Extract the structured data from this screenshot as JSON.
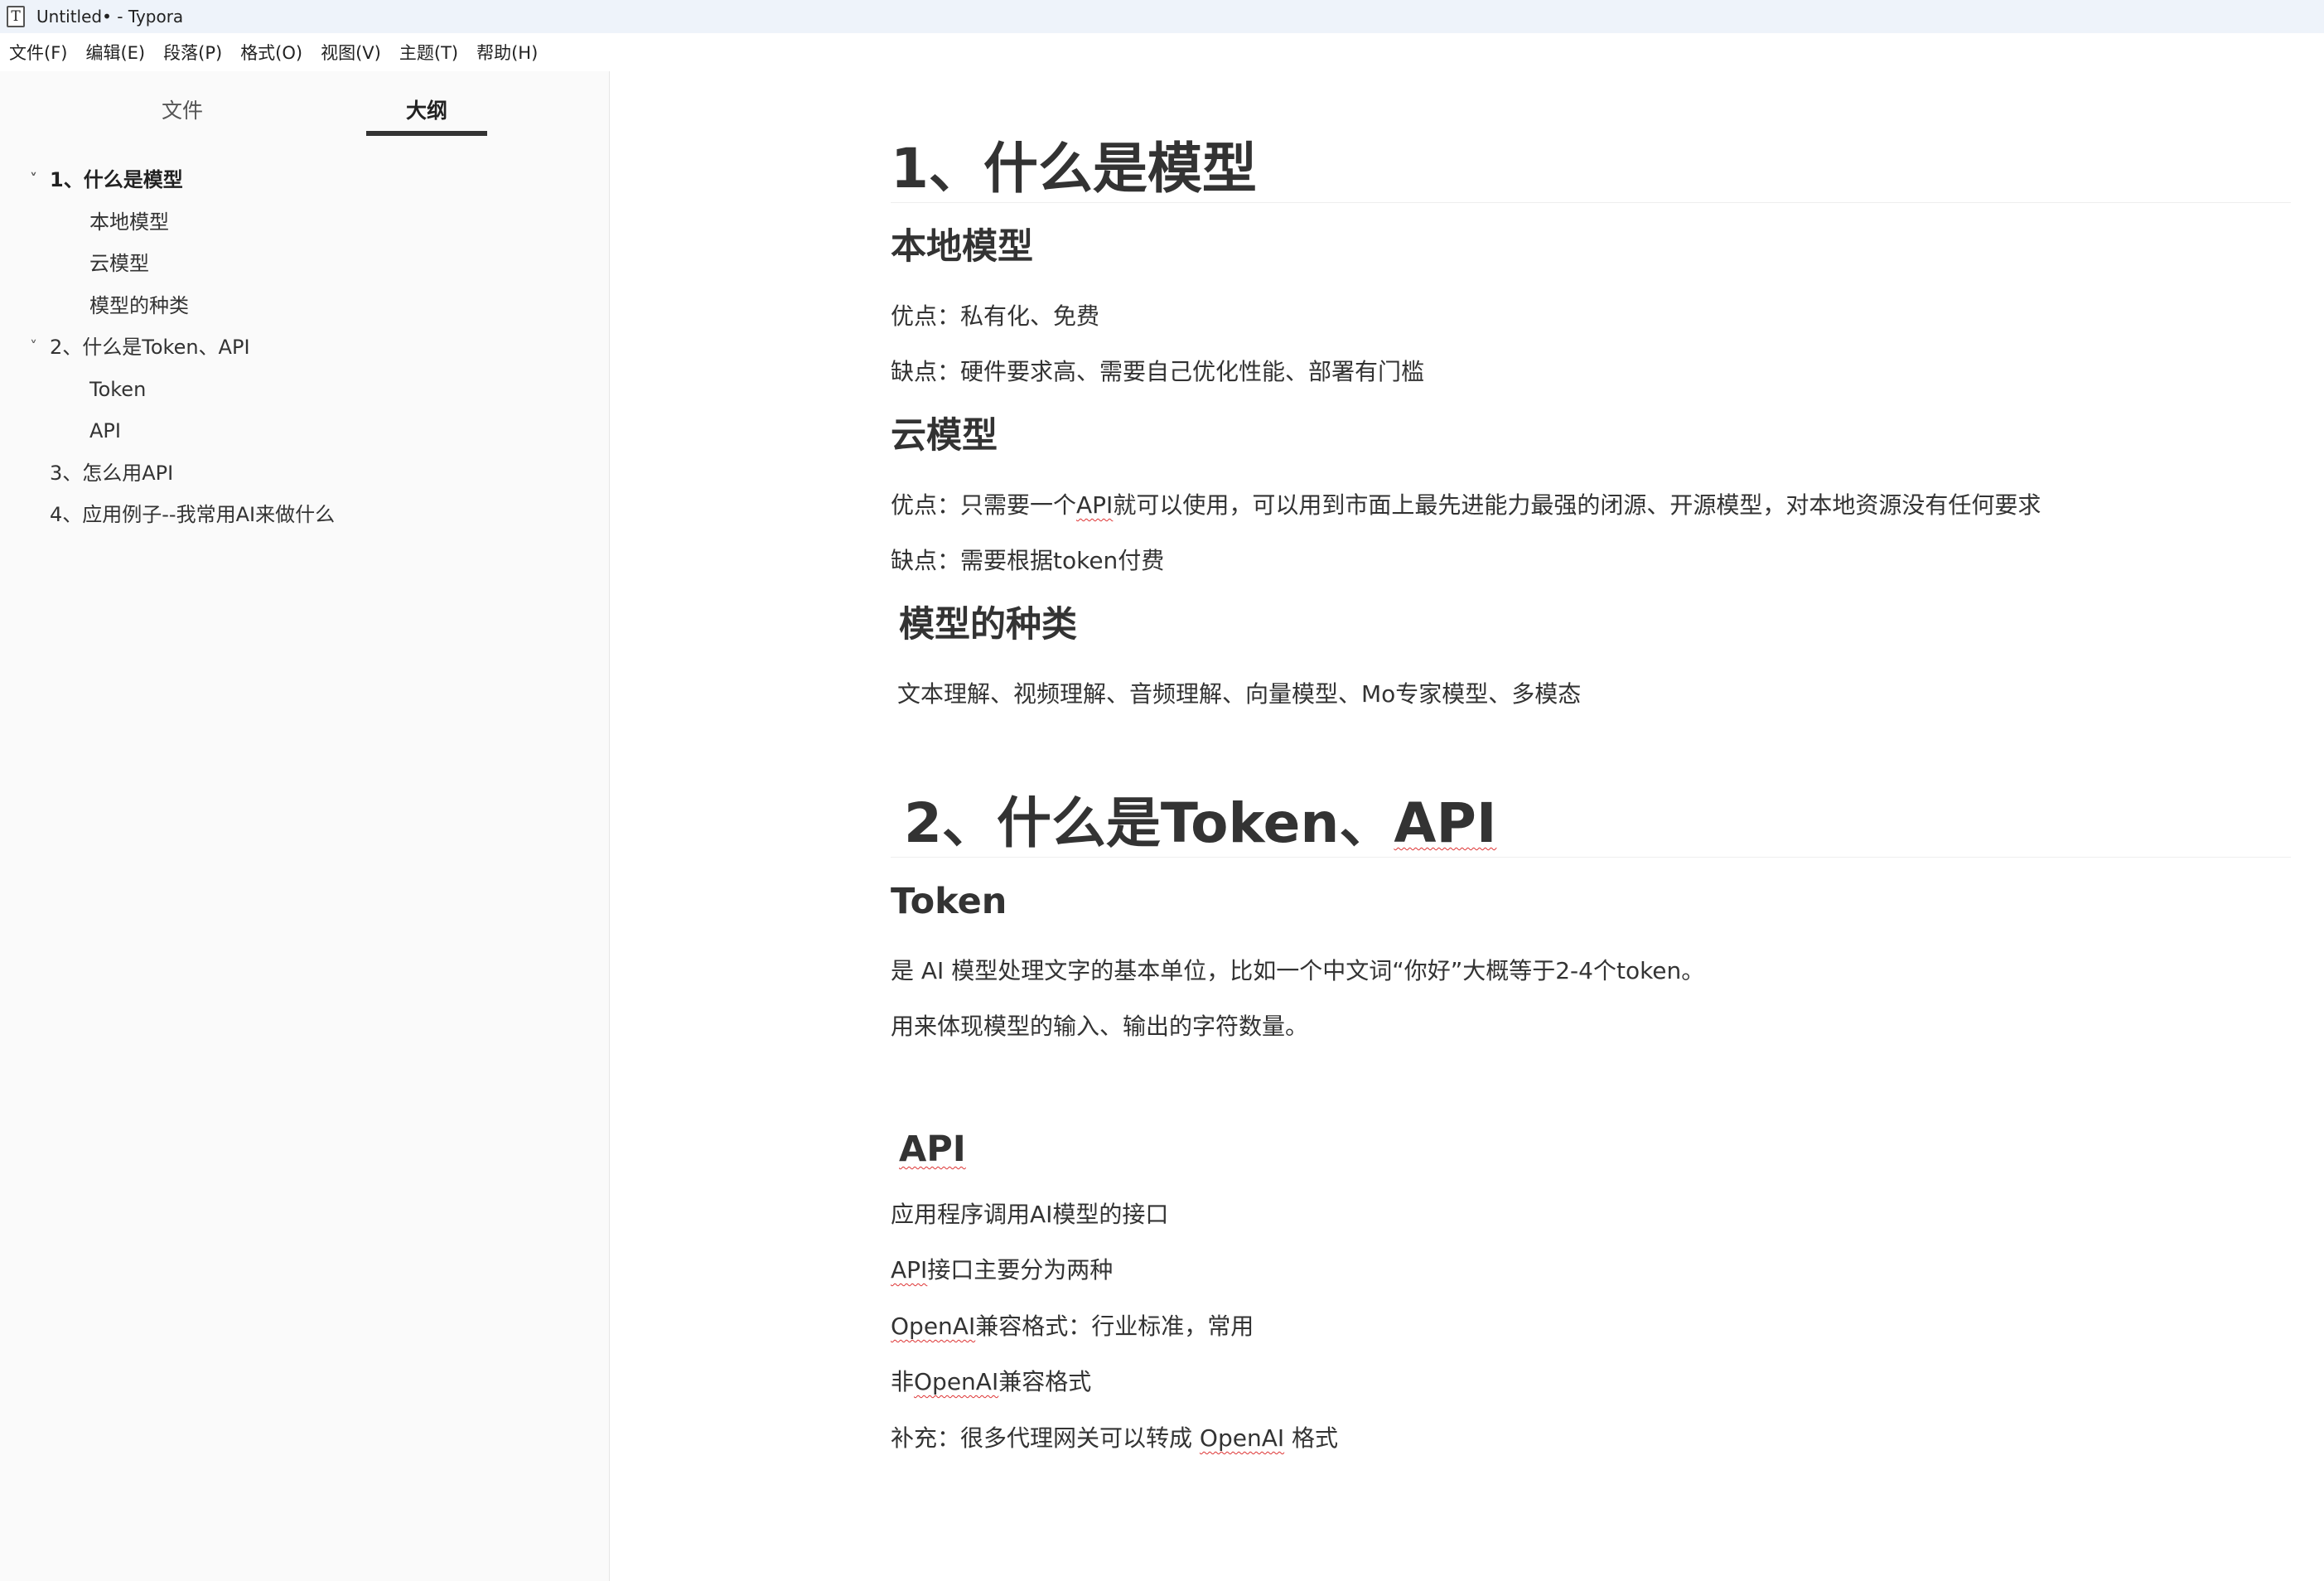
{
  "window": {
    "title": "Untitled• - Typora",
    "icon": "typora-app-icon",
    "icon_glyph": "T"
  },
  "menu": [
    "文件(F)",
    "编辑(E)",
    "段落(P)",
    "格式(O)",
    "视图(V)",
    "主题(T)",
    "帮助(H)"
  ],
  "sidebar": {
    "tabs": {
      "files": "文件",
      "outline": "大纲"
    },
    "outline": [
      {
        "label": "1、什么是模型",
        "level": 1,
        "expanded": true,
        "active": true
      },
      {
        "label": "本地模型",
        "level": 2
      },
      {
        "label": "云模型",
        "level": 2
      },
      {
        "label": "模型的种类",
        "level": 2
      },
      {
        "label": "2、什么是Token、API",
        "level": 1,
        "expanded": true
      },
      {
        "label": "Token",
        "level": 2
      },
      {
        "label": "API",
        "level": 2
      },
      {
        "label": "3、怎么用API",
        "level": 1
      },
      {
        "label": "4、应用例子--我常用AI来做什么",
        "level": 1
      }
    ],
    "chevron_glyph": "˅"
  },
  "doc": {
    "h1_model": "1、什么是模型",
    "h2_local": "本地模型",
    "local_pro": "优点：私有化、免费",
    "local_con": "缺点：硬件要求高、需要自己优化性能、部署有门槛",
    "h2_cloud": "云模型",
    "cloud_pro_a": "优点：只需要一个",
    "cloud_pro_api": "API",
    "cloud_pro_b": "就可以使用，可以用到市面上最先进能力最强的闭源、开源模型，对本地资源没有任何要求",
    "cloud_con": "缺点：需要根据token付费",
    "h2_types": "模型的种类",
    "types_text": "文本理解、视频理解、音频理解、向量模型、Mo专家模型、多模态",
    "h1_token_a": "2、什么是Token、",
    "h1_token_api": "API",
    "h2_token": "Token",
    "token_p1": "是 AI 模型处理文字的基本单位，比如一个中文词“你好”大概等于2-4个token。",
    "token_p2": "用来体现模型的输入、输出的字符数量。",
    "h2_api": "API",
    "api_p1": "应用程序调用AI模型的接口",
    "api_p2_api": "API",
    "api_p2_b": "接口主要分为两种",
    "api_p3_openai": "OpenAI",
    "api_p3_b": "兼容格式：行业标准，常用",
    "api_p4_a": "非",
    "api_p4_openai": "OpenAI",
    "api_p4_b": "兼容格式",
    "api_p5_a": "补充：很多代理网关可以转成 ",
    "api_p5_openai": "OpenAI",
    "api_p5_b": " 格式"
  }
}
